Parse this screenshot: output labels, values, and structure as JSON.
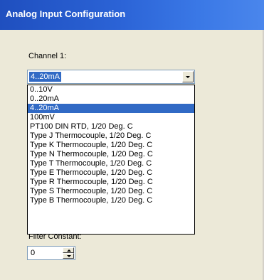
{
  "window": {
    "title": "Analog Input Configuration"
  },
  "colors": {
    "titlebar_start": "#1f4fbf",
    "titlebar_end": "#4a86ec",
    "selection": "#316ac5",
    "dialog_bg": "#ece9d8"
  },
  "channel": {
    "label": "Channel 1:",
    "selected_value": "4..20mA",
    "options": [
      {
        "label": "0..10V",
        "selected": false
      },
      {
        "label": "0..20mA",
        "selected": false
      },
      {
        "label": "4..20mA",
        "selected": true
      },
      {
        "label": "100mV",
        "selected": false
      },
      {
        "label": "PT100 DIN RTD, 1/20 Deg. C",
        "selected": false
      },
      {
        "label": "Type J Thermocouple, 1/20 Deg. C",
        "selected": false
      },
      {
        "label": "Type K Thermocouple, 1/20 Deg. C",
        "selected": false
      },
      {
        "label": "Type N Thermocouple, 1/20 Deg. C",
        "selected": false
      },
      {
        "label": "Type T Thermocouple, 1/20 Deg. C",
        "selected": false
      },
      {
        "label": "Type E Thermocouple, 1/20 Deg. C",
        "selected": false
      },
      {
        "label": "Type R Thermocouple, 1/20 Deg. C",
        "selected": false
      },
      {
        "label": "Type S Thermocouple, 1/20 Deg. C",
        "selected": false
      },
      {
        "label": "Type B Thermocouple, 1/20 Deg. C",
        "selected": false
      }
    ]
  },
  "filter": {
    "label": "Filter Constant:",
    "value": "0"
  },
  "icons": {
    "dropdown": "chevron-down-icon",
    "spin_up": "spin-up-icon",
    "spin_down": "spin-down-icon"
  }
}
